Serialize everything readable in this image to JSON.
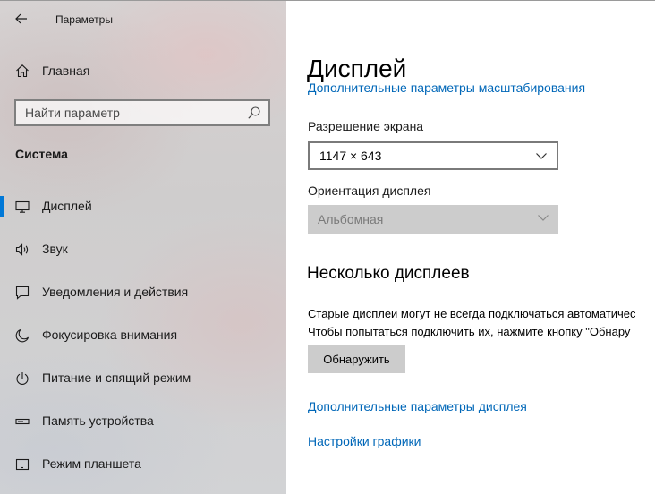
{
  "window": {
    "title": "Параметры",
    "back_icon": "arrow-left-icon"
  },
  "sidebar": {
    "home": {
      "label": "Главная",
      "icon": "home-icon"
    },
    "search": {
      "placeholder": "Найти параметр",
      "icon": "search-icon"
    },
    "section_heading": "Система",
    "items": [
      {
        "label": "Дисплей",
        "icon": "monitor-icon",
        "active": true
      },
      {
        "label": "Звук",
        "icon": "speaker-icon",
        "active": false
      },
      {
        "label": "Уведомления и действия",
        "icon": "notification-icon",
        "active": false
      },
      {
        "label": "Фокусировка внимания",
        "icon": "moon-icon",
        "active": false
      },
      {
        "label": "Питание и спящий режим",
        "icon": "power-icon",
        "active": false
      },
      {
        "label": "Память устройства",
        "icon": "storage-icon",
        "active": false
      },
      {
        "label": "Режим планшета",
        "icon": "tablet-icon",
        "active": false
      }
    ],
    "accent_color": "#0078d7"
  },
  "main": {
    "title": "Дисплей",
    "scaling_link": "Дополнительные параметры масштабирования",
    "resolution": {
      "label": "Разрешение экрана",
      "value": "1147 × 643"
    },
    "orientation": {
      "label": "Ориентация дисплея",
      "value": "Альбомная",
      "disabled": true
    },
    "multiple_displays": {
      "heading": "Несколько дисплеев",
      "text_line1": "Старые дисплеи могут не всегда подключаться автоматичес",
      "text_line2": "Чтобы попытаться подключить их, нажмите кнопку \"Обнару",
      "detect_button": "Обнаружить"
    },
    "advanced_display_link": "Дополнительные параметры дисплея",
    "graphics_settings_link": "Настройки графики",
    "link_color": "#0067b8"
  }
}
